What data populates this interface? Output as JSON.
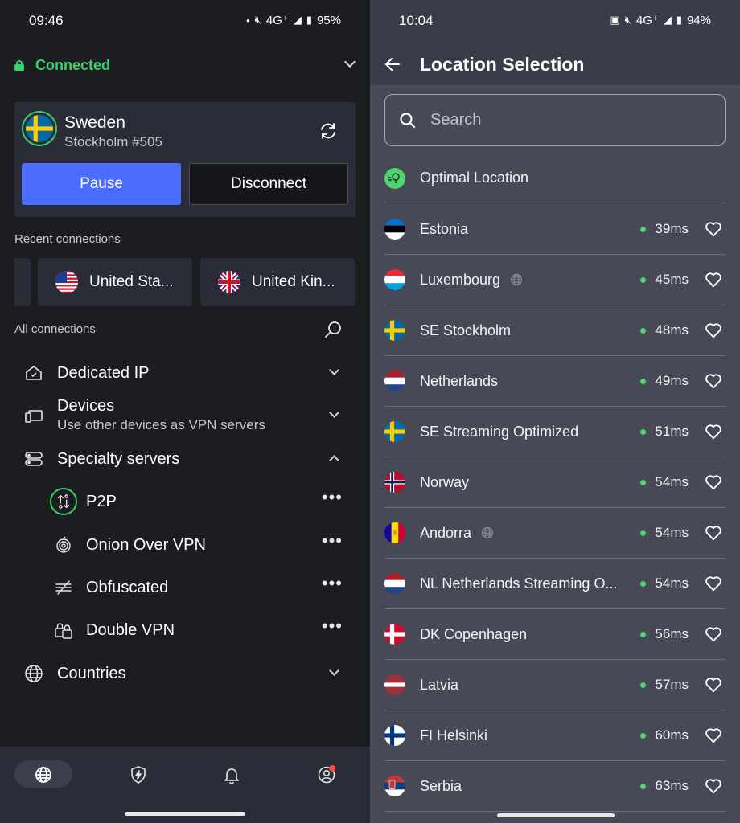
{
  "left": {
    "status": {
      "time": "09:46",
      "network": "4G⁺",
      "battery": "95%"
    },
    "connection_status": "Connected",
    "server": {
      "country": "Sweden",
      "city_server": "Stockholm #505"
    },
    "buttons": {
      "pause": "Pause",
      "disconnect": "Disconnect"
    },
    "recent_label": "Recent connections",
    "recent": [
      {
        "label": "United Sta...",
        "flag": "us"
      },
      {
        "label": "United Kin...",
        "flag": "uk"
      }
    ],
    "all_label": "All connections",
    "menu": {
      "dedicated_ip": "Dedicated IP",
      "devices": "Devices",
      "devices_sub": "Use other devices as VPN servers",
      "specialty": "Specialty servers",
      "countries": "Countries"
    },
    "specialty_items": [
      {
        "label": "P2P",
        "icon": "p2p-icon"
      },
      {
        "label": "Onion Over VPN",
        "icon": "onion-icon"
      },
      {
        "label": "Obfuscated",
        "icon": "obfuscated-icon"
      },
      {
        "label": "Double VPN",
        "icon": "double-vpn-icon"
      }
    ],
    "dots": "•••",
    "nav": [
      "globe-icon",
      "shield-bolt-icon",
      "bell-icon",
      "profile-icon"
    ]
  },
  "right": {
    "status": {
      "time": "10:04",
      "network": "4G⁺",
      "battery": "94%"
    },
    "title": "Location Selection",
    "search_placeholder": "Search",
    "optimal": "Optimal Location",
    "locations": [
      {
        "name": "Estonia",
        "ping": "39ms",
        "virtual": false,
        "flag": "ee"
      },
      {
        "name": "Luxembourg",
        "ping": "45ms",
        "virtual": true,
        "flag": "lu"
      },
      {
        "name": "SE Stockholm",
        "ping": "48ms",
        "virtual": false,
        "flag": "se"
      },
      {
        "name": "Netherlands",
        "ping": "49ms",
        "virtual": false,
        "flag": "nl"
      },
      {
        "name": "SE Streaming Optimized",
        "ping": "51ms",
        "virtual": false,
        "flag": "se"
      },
      {
        "name": "Norway",
        "ping": "54ms",
        "virtual": false,
        "flag": "no"
      },
      {
        "name": "Andorra",
        "ping": "54ms",
        "virtual": true,
        "flag": "ad"
      },
      {
        "name": "NL Netherlands Streaming O...",
        "ping": "54ms",
        "virtual": false,
        "flag": "nl"
      },
      {
        "name": "DK Copenhagen",
        "ping": "56ms",
        "virtual": false,
        "flag": "dk"
      },
      {
        "name": "Latvia",
        "ping": "57ms",
        "virtual": false,
        "flag": "lv"
      },
      {
        "name": "FI Helsinki",
        "ping": "60ms",
        "virtual": false,
        "flag": "fi"
      },
      {
        "name": "Serbia",
        "ping": "63ms",
        "virtual": false,
        "flag": "rs"
      }
    ]
  },
  "colors": {
    "accent_green": "#3ad06a",
    "accent_blue": "#4a6cff",
    "notification_red": "#ff4a4a"
  }
}
